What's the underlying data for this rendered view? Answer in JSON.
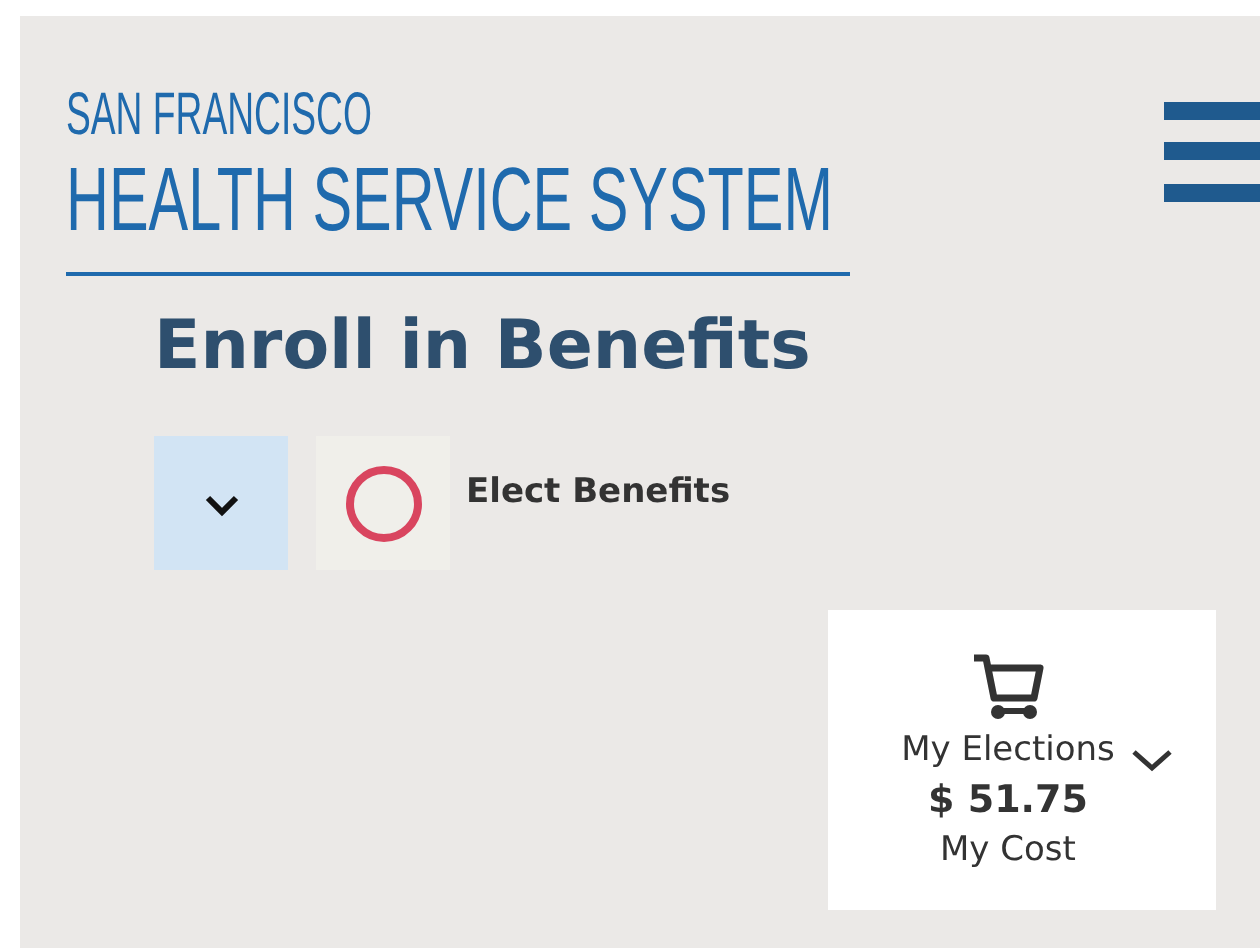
{
  "header": {
    "logo_line_1": "SAN FRANCISCO",
    "logo_line_2": "HEALTH SERVICE SYSTEM"
  },
  "title": "Enroll in Benefits",
  "step": {
    "label": "Elect Benefits",
    "expanded": false,
    "completed": false
  },
  "elections": {
    "label": "My Elections",
    "amount": "$ 51.75",
    "caption": "My Cost",
    "expanded": false
  }
}
